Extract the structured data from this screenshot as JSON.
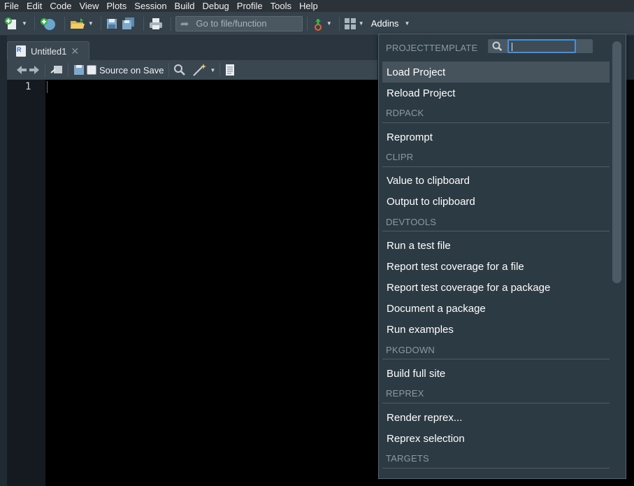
{
  "menubar": {
    "items": [
      "File",
      "Edit",
      "Code",
      "View",
      "Plots",
      "Session",
      "Build",
      "Debug",
      "Profile",
      "Tools",
      "Help"
    ]
  },
  "toolbar": {
    "goto_placeholder": "Go to file/function",
    "addins_label": "Addins"
  },
  "editor_tab": {
    "title": "Untitled1"
  },
  "editor_toolbar": {
    "source_on_save_label": "Source on Save"
  },
  "editor": {
    "line_numbers": [
      "1"
    ]
  },
  "addins_menu": {
    "search_placeholder": "",
    "sections": [
      {
        "header": "PROJECTTEMPLATE",
        "items": [
          "Load Project",
          "Reload Project"
        ]
      },
      {
        "header": "RDPACK",
        "items": [
          "Reprompt"
        ]
      },
      {
        "header": "CLIPR",
        "items": [
          "Value to clipboard",
          "Output to clipboard"
        ]
      },
      {
        "header": "DEVTOOLS",
        "items": [
          "Run a test file",
          "Report test coverage for a file",
          "Report test coverage for a package",
          "Document a package",
          "Run examples"
        ]
      },
      {
        "header": "PKGDOWN",
        "items": [
          "Build full site"
        ]
      },
      {
        "header": "REPREX",
        "items": [
          "Render reprex...",
          "Reprex selection"
        ]
      },
      {
        "header": "TARGETS",
        "items": []
      }
    ],
    "selected_item": "Load Project"
  }
}
